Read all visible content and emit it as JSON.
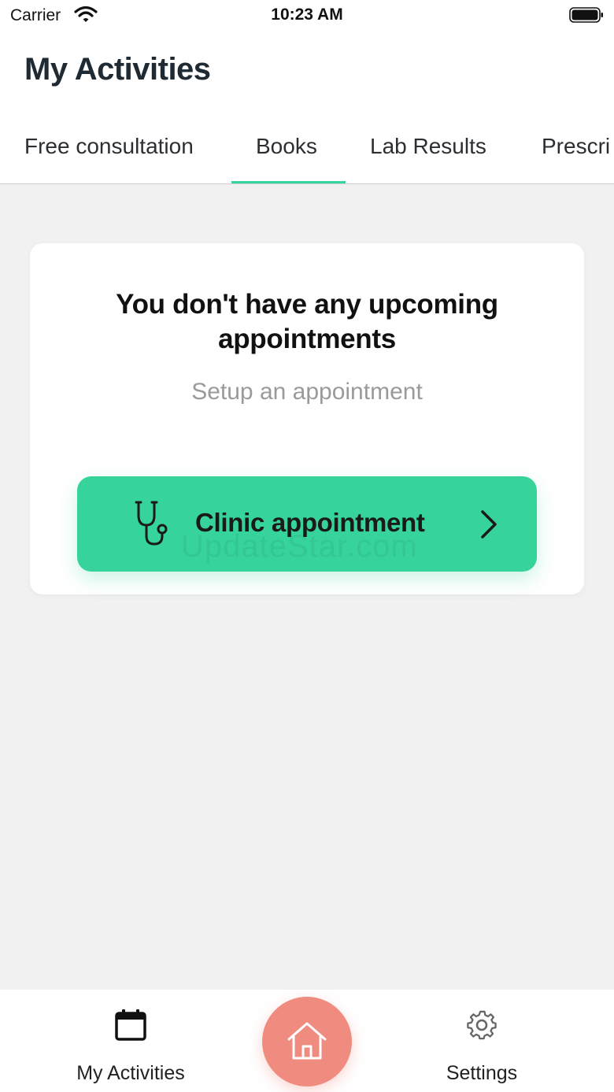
{
  "status_bar": {
    "carrier": "Carrier",
    "time": "10:23 AM",
    "wifi_icon": "wifi-icon",
    "battery_icon": "battery-icon"
  },
  "header": {
    "title": "My Activities"
  },
  "tabs": [
    {
      "label": "Free consultation",
      "active": false
    },
    {
      "label": "Books",
      "active": true
    },
    {
      "label": "Lab Results",
      "active": false
    },
    {
      "label": "Prescri",
      "active": false
    }
  ],
  "empty_state": {
    "title": "You don't have any upcoming appointments",
    "subtitle": "Setup an appointment",
    "button_label": "Clinic appointment",
    "button_icon": "stethoscope-icon",
    "chevron_icon": "chevron-right-icon"
  },
  "watermark": "UpdateStar.com",
  "bottom_nav": {
    "left_label": "My Activities",
    "left_icon": "calendar-icon",
    "center_icon": "home-icon",
    "right_label": "Settings",
    "right_icon": "gear-icon"
  },
  "colors": {
    "accent": "#36d39a",
    "home_button": "#f08b80",
    "background": "#f1f1f1",
    "subtitle_text": "#9a9a9a"
  }
}
